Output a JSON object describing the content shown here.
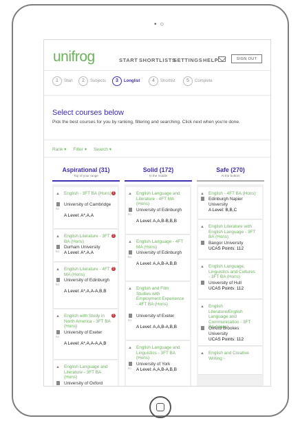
{
  "device": {
    "camera": "• ○"
  },
  "app": {
    "logo": "unifrog",
    "nav": [
      "START",
      "SHORTLISTS",
      "SETTINGS",
      "HELP"
    ],
    "sign_out": "SIGN OUT"
  },
  "steps": [
    {
      "num": "1",
      "label": "Start"
    },
    {
      "num": "2",
      "label": "Subjects"
    },
    {
      "num": "3",
      "label": "Longlist",
      "active": true
    },
    {
      "num": "4",
      "label": "Shortlist"
    },
    {
      "num": "5",
      "label": "Complete"
    }
  ],
  "page": {
    "headline": "Select courses below",
    "intro": "Pick the best courses for you by ranking, filtering and searching. Click next when you're done."
  },
  "filters": {
    "rank": "Rank ▾",
    "filter": "Filter ▾",
    "search": "Search ▾"
  },
  "columns": [
    {
      "title": "Aspirational (31)",
      "subtitle": "Top of your range",
      "cards": [
        {
          "course": "English - 3FT BA (Hons)",
          "university": "University of Cambridge",
          "requirement": "A Level: A*,A,A",
          "alert": "!"
        },
        {
          "course": "English Literature - 3FT BA (Hons)",
          "university": "Durham University",
          "requirement": "A Level: A*,A,A",
          "alert": "!"
        },
        {
          "course": "English Literature - 4FT MA (Hons)",
          "university": "University of Edinburgh",
          "requirement": "A Level: A*,A,A-A,B,B",
          "alert": "!"
        },
        {
          "course": "English with Study in North America - 3FT BA (Hons)",
          "university": "University of Exeter",
          "requirement": "A Level: A*,A,A-A,A,B",
          "alert": "!"
        },
        {
          "course": "English Language and Literature - 3FT BA (Hons)",
          "university": "University of Oxford",
          "requirement": "",
          "alert": ""
        }
      ]
    },
    {
      "title": "Solid (172)",
      "subtitle": "In the middle",
      "cards": [
        {
          "course": "English Language and Literature - 4FT MA (Hons)",
          "university": "University of Edinburgh",
          "requirement": "A Level: A,A,B-B,B,B"
        },
        {
          "course": "English Language - 4FT MA (Hons)",
          "university": "University of Edinburgh",
          "requirement": "A Level: A,A,B-A,B,B"
        },
        {
          "course": "English and Film Studies with Employment Experience - 4FT BA (Hons)",
          "university": "University of Exeter",
          "requirement": "A Level: A,A,B-A,B,B"
        },
        {
          "course": "English Language and Linguistics - 3FT BA (Hons)",
          "university": "University of York",
          "requirement": "A Level: A,A,B-A,B,B"
        }
      ]
    },
    {
      "title": "Safe (270)",
      "subtitle": "At the bottom",
      "cards": [
        {
          "course": "English - 4FT BA (Hons)",
          "university": "Edinburgh Napier University",
          "requirement": "A Level: B,B,C"
        },
        {
          "course": "English Literature with English Language - 3FT BA (Hons)",
          "university": "Bangor University",
          "requirement": "UCAS Points: 112"
        },
        {
          "course": "English Language, Linguistics and Cultures - 3FT BA (Hons)",
          "university": "University of Hull",
          "requirement": "UCAS Points: 112"
        },
        {
          "course": "English Literature/English Language and Communication - 3FT BA (Hons)",
          "university": "Oxford Brookes University",
          "requirement": "UCAS Points: 112"
        },
        {
          "course": "English and Creative Writing -",
          "university": "",
          "requirement": ""
        }
      ]
    }
  ],
  "labels": {
    "rg": "RG"
  },
  "colors": {
    "brand_green": "#6ab25b",
    "accent_purple": "#3d2fb0",
    "alert_red": "#c23a3a"
  }
}
